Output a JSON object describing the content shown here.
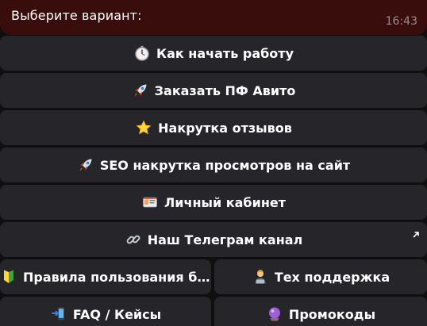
{
  "message": {
    "text": "Выберите вариант:",
    "time": "16:43"
  },
  "keyboard": {
    "buttons": [
      {
        "label": "Как начать работу",
        "icon": "stopwatch-icon"
      },
      {
        "label": "Заказать ПФ Авито",
        "icon": "rocket-icon"
      },
      {
        "label": "Накрутка отзывов",
        "icon": "star-icon"
      },
      {
        "label": "SEO накрутка просмотров на сайт",
        "icon": "rocket-icon"
      },
      {
        "label": "Личный кабинет",
        "icon": "id-card-icon"
      },
      {
        "label": "Наш Телеграм канал",
        "icon": "link-icon",
        "url_button": true
      },
      {
        "label": "Правила пользования б...",
        "icon": "beginner-badge-icon"
      },
      {
        "label": "Тех поддержка",
        "icon": "technologist-icon"
      },
      {
        "label": "FAQ / Кейсы",
        "icon": "phone-arrow-icon"
      },
      {
        "label": "Промокоды",
        "icon": "crystal-ball-icon"
      }
    ]
  },
  "colors": {
    "message_bubble": "#3a0d0d",
    "button_bg": "#25252a",
    "background": "#0f0f10",
    "time_text": "#9a8e8e"
  }
}
